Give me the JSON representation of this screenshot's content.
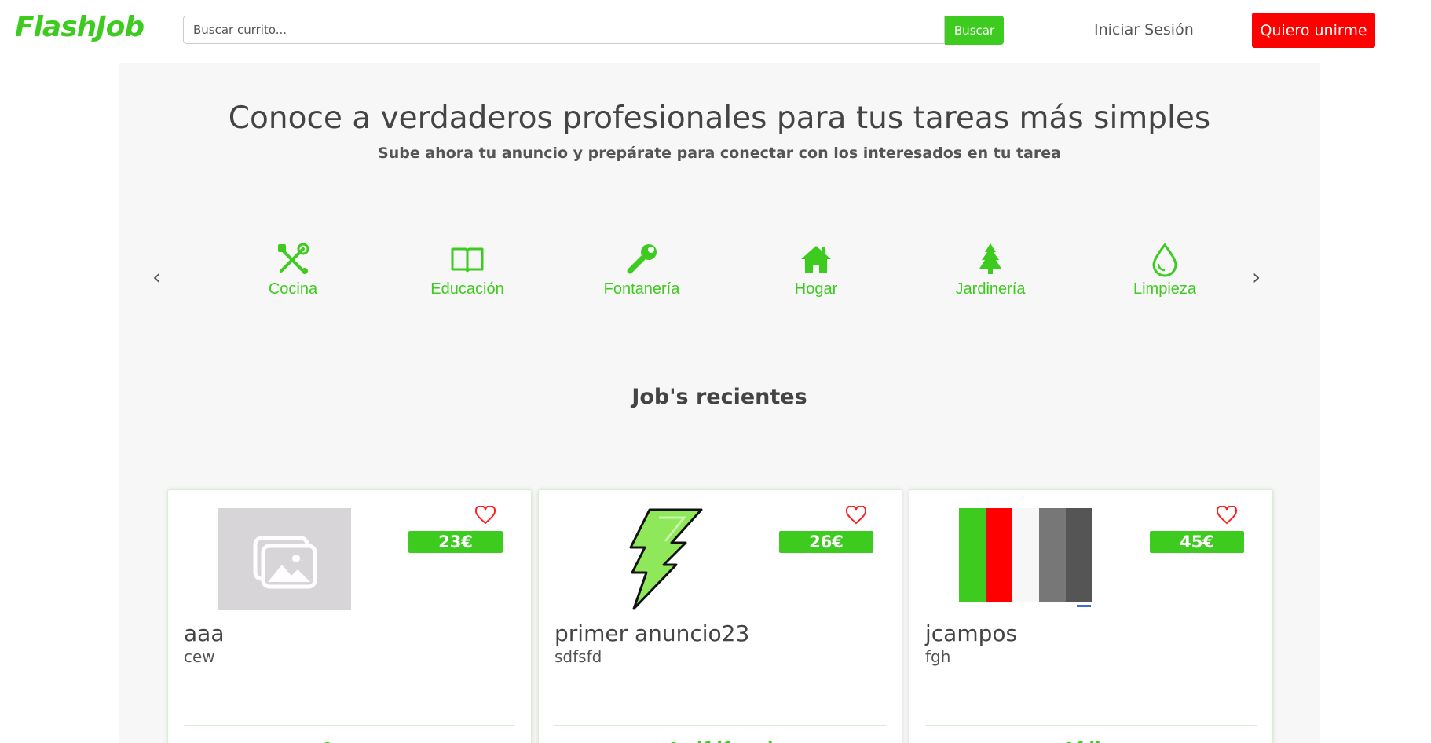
{
  "header": {
    "logo": "FlashJob",
    "search_placeholder": "Buscar currito...",
    "search_button": "Buscar",
    "login": "Iniciar Sesión",
    "join": "Quiero unirme"
  },
  "hero": {
    "title": "Conoce a verdaderos profesionales para tus tareas más simples",
    "subtitle": "Sube ahora tu anuncio y prepárate para conectar con los interesados en tu tarea"
  },
  "categories": [
    {
      "label": "Cocina",
      "icon": "tools-icon"
    },
    {
      "label": "Educación",
      "icon": "book-icon"
    },
    {
      "label": "Fontanería",
      "icon": "wrench-icon"
    },
    {
      "label": "Hogar",
      "icon": "house-icon"
    },
    {
      "label": "Jardinería",
      "icon": "tree-icon"
    },
    {
      "label": "Limpieza",
      "icon": "drop-icon"
    }
  ],
  "recent": {
    "title": "Job's recientes",
    "cards": [
      {
        "title": "aaa",
        "description": "cew",
        "price": "23€",
        "location": "sevv",
        "image": "placeholder-image-icon"
      },
      {
        "title": "primer anuncio23",
        "description": "sdfsfd",
        "price": "26€",
        "location": "sdfdfsssd",
        "image": "lightning-icon"
      },
      {
        "title": "jcampos",
        "description": "fgh",
        "price": "45€",
        "location": "fdbg",
        "image": "color-palette-image"
      }
    ]
  },
  "colors": {
    "brand_green": "#3ecb1f",
    "join_red": "#ff0000",
    "text_dark": "#444444"
  }
}
